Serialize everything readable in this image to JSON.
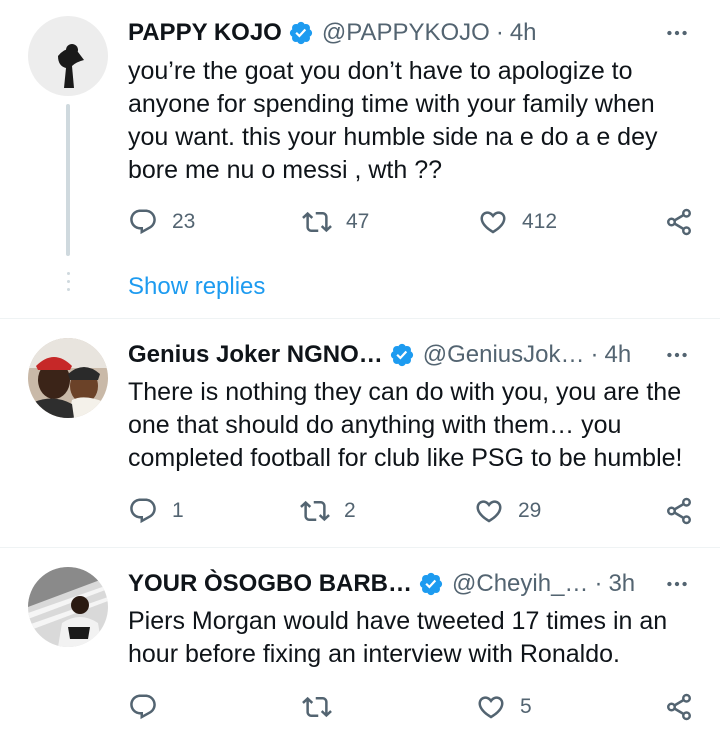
{
  "tweets": [
    {
      "name": "PAPPY KOJO",
      "handle": "@PAPPYKOJO",
      "separator": "·",
      "time": "4h",
      "lines": [
        "you’re the goat you don’t have to  apologize to",
        "anyone for spending time with your family when",
        "you want. this your humble side na e do a e dey",
        "bore me nu o messi , wth ??"
      ],
      "replies": "23",
      "retweets": "47",
      "likes": "412",
      "show_replies": "Show replies"
    },
    {
      "name": "Genius Joker NGNO…",
      "handle": "@GeniusJok…",
      "separator": "·",
      "time": "4h",
      "lines": [
        "There is nothing they can do with you, you are the",
        "one that should do anything with them… you",
        "completed football for club like PSG to be humble!"
      ],
      "replies": "1",
      "retweets": "2",
      "likes": "29"
    },
    {
      "name": "YOUR ÒSOGBO BARB…",
      "handle": "@Cheyih_…",
      "separator": "·",
      "time": "3h",
      "lines": [
        "Piers Morgan would have tweeted 17 times in an",
        "hour before fixing an interview with Ronaldo."
      ],
      "replies": "",
      "retweets": "",
      "likes": "5"
    }
  ],
  "icons": {
    "verified": "verified-badge-icon",
    "more": "more-options-icon",
    "reply": "reply-icon",
    "retweet": "retweet-icon",
    "like": "like-icon",
    "share": "share-icon"
  },
  "colors": {
    "accent": "#1d9bf0",
    "text": "#0f1419",
    "secondary": "#536471",
    "divider": "#eff3f4",
    "thread": "#cfd9de"
  }
}
